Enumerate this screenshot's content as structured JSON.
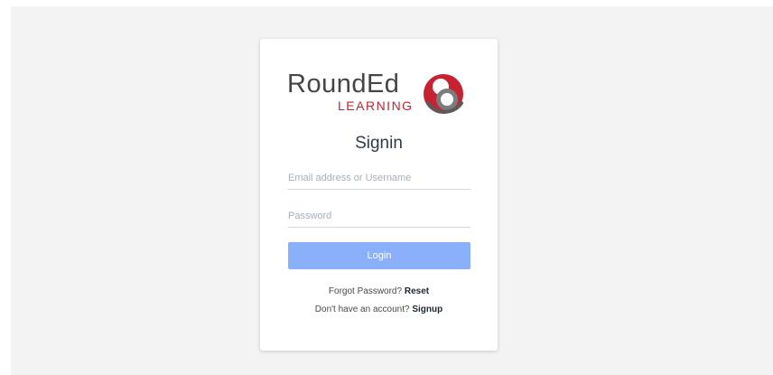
{
  "brand": {
    "name": "RoundEd",
    "subtitle": "LEARNING",
    "colors": {
      "primary": "#c62332",
      "dark": "#454545",
      "button": "#8bb0fb"
    }
  },
  "form": {
    "title": "Signin",
    "email_placeholder": "Email address or Username",
    "password_placeholder": "Password",
    "login_label": "Login"
  },
  "links": {
    "forgot_text": "Forgot Password?",
    "reset_label": "Reset",
    "signup_text": "Don't have an account?",
    "signup_label": "Signup"
  }
}
